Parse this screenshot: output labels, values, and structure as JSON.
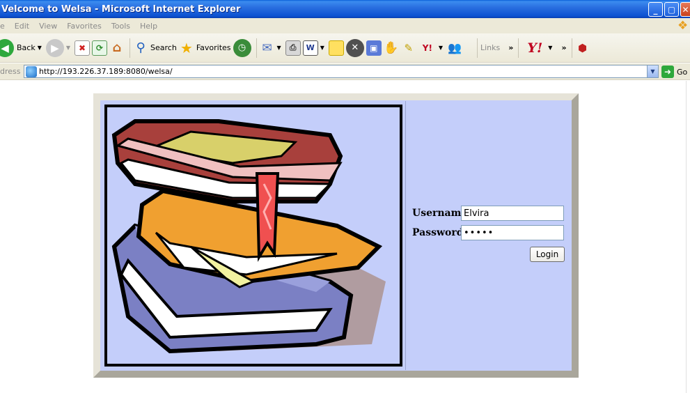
{
  "window": {
    "title": "Welcome to Welsa - Microsoft Internet Explorer",
    "title_visible": "Velcome to Welsa - Microsoft Internet Explorer",
    "buttons": [
      "minimize",
      "maximize",
      "close"
    ]
  },
  "menu": {
    "items": [
      "e",
      "Edit",
      "View",
      "Favorites",
      "Tools",
      "Help"
    ]
  },
  "toolbar": {
    "back_label": "Back",
    "search_label": "Search",
    "favorites_label": "Favorites",
    "links_label": "Links",
    "chevron": "»"
  },
  "address": {
    "label": "dress",
    "url": "http://193.226.37.189:8080/welsa/",
    "go_label": "Go"
  },
  "login": {
    "username_label": "Username",
    "username_value": "Elvira",
    "password_label": "Password",
    "password_value": "•••••",
    "button_label": "Login"
  },
  "colors": {
    "panel_bg": "#c4cefa",
    "titlebar": "#0d52d2",
    "chrome": "#ece9d8"
  }
}
